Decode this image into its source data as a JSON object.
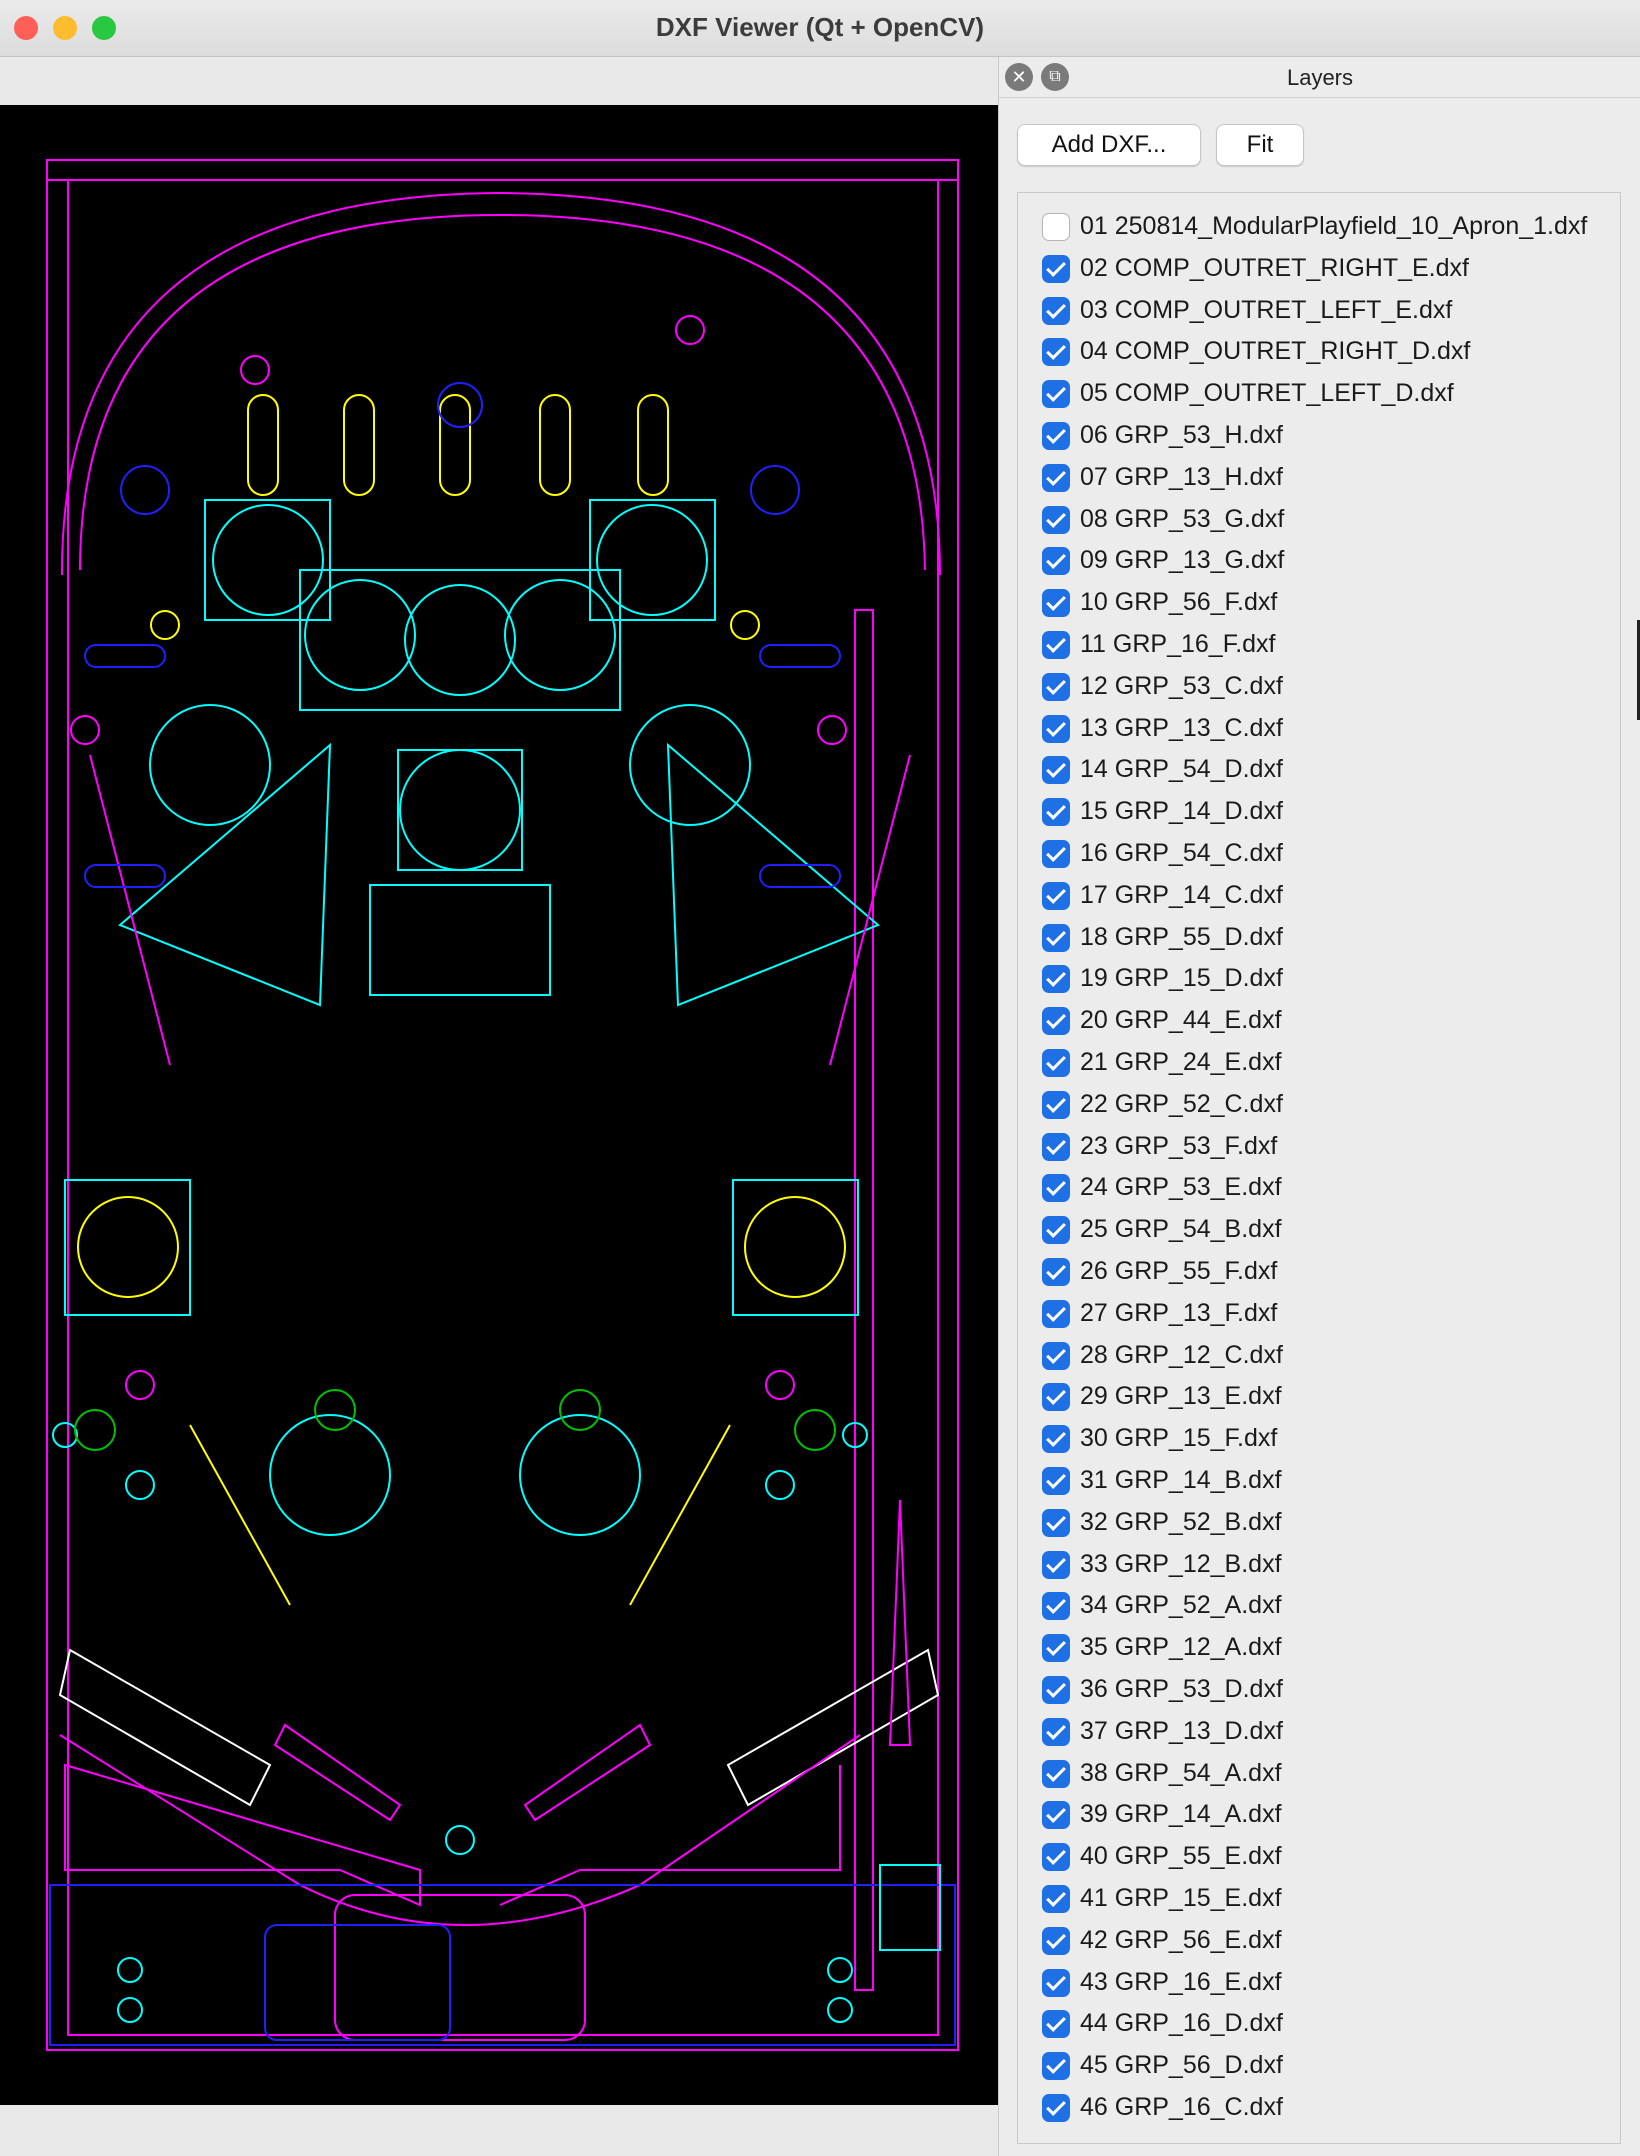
{
  "window": {
    "title": "DXF Viewer (Qt + OpenCV)"
  },
  "dock": {
    "title": "Layers",
    "add_label": "Add DXF...",
    "fit_label": "Fit"
  },
  "colors": {
    "background": "#000000",
    "magenta": "#ff00ff",
    "cyan": "#00ffff",
    "yellow": "#ffff00",
    "blue": "#2020ff",
    "green": "#00c000",
    "white": "#ffffff",
    "checkbox": "#1f6fe5"
  },
  "layers": [
    {
      "label": "01  250814_ModularPlayfield_10_Apron_1.dxf",
      "checked": false
    },
    {
      "label": "02  COMP_OUTRET_RIGHT_E.dxf",
      "checked": true
    },
    {
      "label": "03  COMP_OUTRET_LEFT_E.dxf",
      "checked": true
    },
    {
      "label": "04  COMP_OUTRET_RIGHT_D.dxf",
      "checked": true
    },
    {
      "label": "05  COMP_OUTRET_LEFT_D.dxf",
      "checked": true
    },
    {
      "label": "06  GRP_53_H.dxf",
      "checked": true
    },
    {
      "label": "07  GRP_13_H.dxf",
      "checked": true
    },
    {
      "label": "08  GRP_53_G.dxf",
      "checked": true
    },
    {
      "label": "09  GRP_13_G.dxf",
      "checked": true
    },
    {
      "label": "10  GRP_56_F.dxf",
      "checked": true
    },
    {
      "label": "11  GRP_16_F.dxf",
      "checked": true
    },
    {
      "label": "12  GRP_53_C.dxf",
      "checked": true
    },
    {
      "label": "13  GRP_13_C.dxf",
      "checked": true
    },
    {
      "label": "14  GRP_54_D.dxf",
      "checked": true
    },
    {
      "label": "15  GRP_14_D.dxf",
      "checked": true
    },
    {
      "label": "16  GRP_54_C.dxf",
      "checked": true
    },
    {
      "label": "17  GRP_14_C.dxf",
      "checked": true
    },
    {
      "label": "18  GRP_55_D.dxf",
      "checked": true
    },
    {
      "label": "19  GRP_15_D.dxf",
      "checked": true
    },
    {
      "label": "20  GRP_44_E.dxf",
      "checked": true
    },
    {
      "label": "21  GRP_24_E.dxf",
      "checked": true
    },
    {
      "label": "22  GRP_52_C.dxf",
      "checked": true
    },
    {
      "label": "23  GRP_53_F.dxf",
      "checked": true
    },
    {
      "label": "24  GRP_53_E.dxf",
      "checked": true
    },
    {
      "label": "25  GRP_54_B.dxf",
      "checked": true
    },
    {
      "label": "26  GRP_55_F.dxf",
      "checked": true
    },
    {
      "label": "27  GRP_13_F.dxf",
      "checked": true
    },
    {
      "label": "28  GRP_12_C.dxf",
      "checked": true
    },
    {
      "label": "29  GRP_13_E.dxf",
      "checked": true
    },
    {
      "label": "30  GRP_15_F.dxf",
      "checked": true
    },
    {
      "label": "31  GRP_14_B.dxf",
      "checked": true
    },
    {
      "label": "32  GRP_52_B.dxf",
      "checked": true
    },
    {
      "label": "33  GRP_12_B.dxf",
      "checked": true
    },
    {
      "label": "34  GRP_52_A.dxf",
      "checked": true
    },
    {
      "label": "35  GRP_12_A.dxf",
      "checked": true
    },
    {
      "label": "36  GRP_53_D.dxf",
      "checked": true
    },
    {
      "label": "37  GRP_13_D.dxf",
      "checked": true
    },
    {
      "label": "38  GRP_54_A.dxf",
      "checked": true
    },
    {
      "label": "39  GRP_14_A.dxf",
      "checked": true
    },
    {
      "label": "40  GRP_55_E.dxf",
      "checked": true
    },
    {
      "label": "41  GRP_15_E.dxf",
      "checked": true
    },
    {
      "label": "42  GRP_56_E.dxf",
      "checked": true
    },
    {
      "label": "43  GRP_16_E.dxf",
      "checked": true
    },
    {
      "label": "44  GRP_16_D.dxf",
      "checked": true
    },
    {
      "label": "45  GRP_56_D.dxf",
      "checked": true
    },
    {
      "label": "46  GRP_16_C.dxf",
      "checked": true
    }
  ]
}
